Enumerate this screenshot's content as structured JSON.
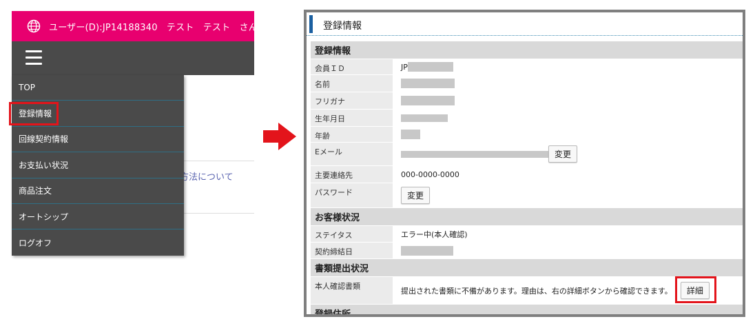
{
  "left": {
    "topbar_user": "ユーザー(D):JP14188340　テスト　テスト　さん　[",
    "brand_color": "#e8006f",
    "menu": [
      {
        "label": "TOP"
      },
      {
        "label": "登録情報"
      },
      {
        "label": "回線契約情報"
      },
      {
        "label": "お支払い状況"
      },
      {
        "label": "商品注文"
      },
      {
        "label": "オートシップ"
      },
      {
        "label": "ログオフ"
      }
    ],
    "behind_link": "方法について"
  },
  "right": {
    "title": "登録情報",
    "sections": {
      "reg": "登録情報",
      "cust": "お客様状況",
      "docs": "書類提出状況",
      "addr": "登録住所"
    },
    "fields": {
      "member_id_label": "会員ＩＤ",
      "member_id_prefix": "JP",
      "name_label": "名前",
      "furigana_label": "フリガナ",
      "birth_label": "生年月日",
      "age_label": "年齢",
      "email_label": "Eメール",
      "phone_label": "主要連絡先",
      "phone_value": "000-0000-0000",
      "password_label": "パスワード",
      "status_label": "ステイタス",
      "status_value": "エラー中(本人確認)",
      "contract_label": "契約締結日",
      "id_doc_label": "本人確認書類",
      "id_doc_value": "提出された書類に不備があります。理由は、右の詳細ボタンから確認できます。"
    },
    "buttons": {
      "change": "変更",
      "detail": "詳細"
    }
  },
  "highlight_color": "#e3141b"
}
